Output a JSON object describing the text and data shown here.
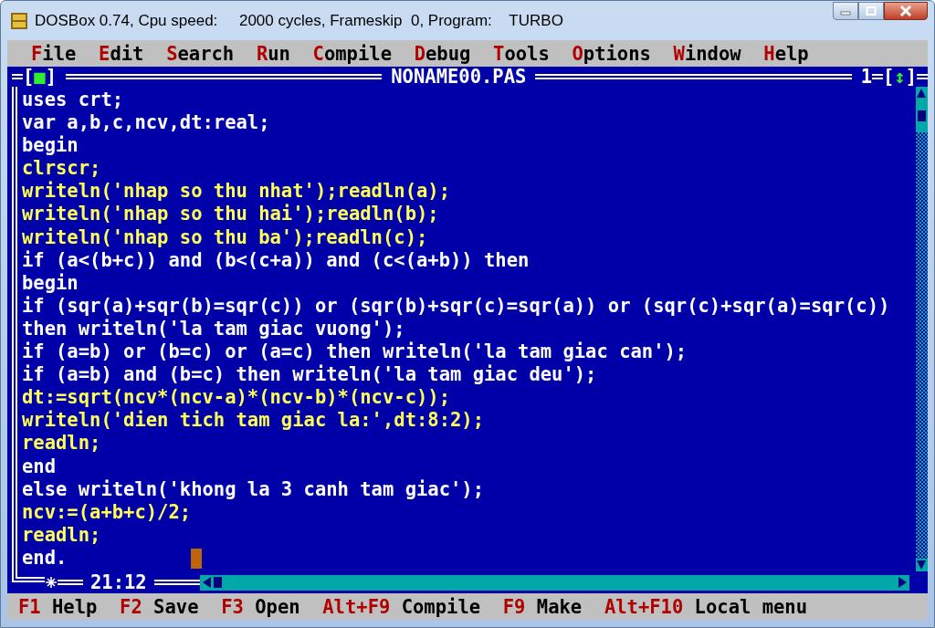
{
  "window": {
    "title": "DOSBox 0.74, Cpu speed:     2000 cycles, Frameskip  0, Program:    TURBO"
  },
  "menu": [
    {
      "hotkey": "F",
      "rest": "ile"
    },
    {
      "hotkey": "E",
      "rest": "dit"
    },
    {
      "hotkey": "S",
      "rest": "earch"
    },
    {
      "hotkey": "R",
      "rest": "un"
    },
    {
      "hotkey": "C",
      "rest": "ompile"
    },
    {
      "hotkey": "D",
      "rest": "ebug"
    },
    {
      "hotkey": "T",
      "rest": "ools"
    },
    {
      "hotkey": "O",
      "rest": "ptions"
    },
    {
      "hotkey": "W",
      "rest": "indow"
    },
    {
      "hotkey": "H",
      "rest": "elp"
    }
  ],
  "editor": {
    "close_box": "[■]",
    "title": "NONAME00.PAS",
    "window_number": "1",
    "zoom_box": "[↕]",
    "position": "21:12",
    "lines": [
      {
        "text": "uses crt;",
        "highlighted": true
      },
      {
        "text": "var a,b,c,ncv,dt:real;",
        "highlighted": true
      },
      {
        "text": "begin",
        "highlighted": true
      },
      {
        "text": "clrscr;",
        "highlighted": false
      },
      {
        "text": "writeln('nhap so thu nhat');readln(a);",
        "highlighted": false
      },
      {
        "text": "writeln('nhap so thu hai');readln(b);",
        "highlighted": false
      },
      {
        "text": "writeln('nhap so thu ba');readln(c);",
        "highlighted": false
      },
      {
        "text": "if (a<(b+c)) and (b<(c+a)) and (c<(a+b)) then",
        "highlighted": true
      },
      {
        "text": "begin",
        "highlighted": true
      },
      {
        "text": "if (sqr(a)+sqr(b)=sqr(c)) or (sqr(b)+sqr(c)=sqr(a)) or (sqr(c)+sqr(a)=sqr(c))",
        "highlighted": true
      },
      {
        "text": "then writeln('la tam giac vuong');",
        "highlighted": true
      },
      {
        "text": "if (a=b) or (b=c) or (a=c) then writeln('la tam giac can');",
        "highlighted": true
      },
      {
        "text": "if (a=b) and (b=c) then writeln('la tam giac deu');",
        "highlighted": true
      },
      {
        "text": "dt:=sqrt(ncv*(ncv-a)*(ncv-b)*(ncv-c));",
        "highlighted": false
      },
      {
        "text": "writeln('dien tich tam giac la:',dt:8:2);",
        "highlighted": false
      },
      {
        "text": "readln;",
        "highlighted": false
      },
      {
        "text": "end",
        "highlighted": true
      },
      {
        "text": "else writeln('khong la 3 canh tam giac');",
        "highlighted": true
      },
      {
        "text": "ncv:=(a+b+c)/2;",
        "highlighted": false
      },
      {
        "text": "readln;",
        "highlighted": false
      },
      {
        "text": "end.",
        "highlighted": true
      }
    ]
  },
  "status_bar": [
    {
      "key": "F1",
      "label": "Help"
    },
    {
      "key": "F2",
      "label": "Save"
    },
    {
      "key": "F3",
      "label": "Open"
    },
    {
      "key": "Alt+F9",
      "label": "Compile"
    },
    {
      "key": "F9",
      "label": "Make"
    },
    {
      "key": "Alt+F10",
      "label": "Local menu"
    }
  ]
}
